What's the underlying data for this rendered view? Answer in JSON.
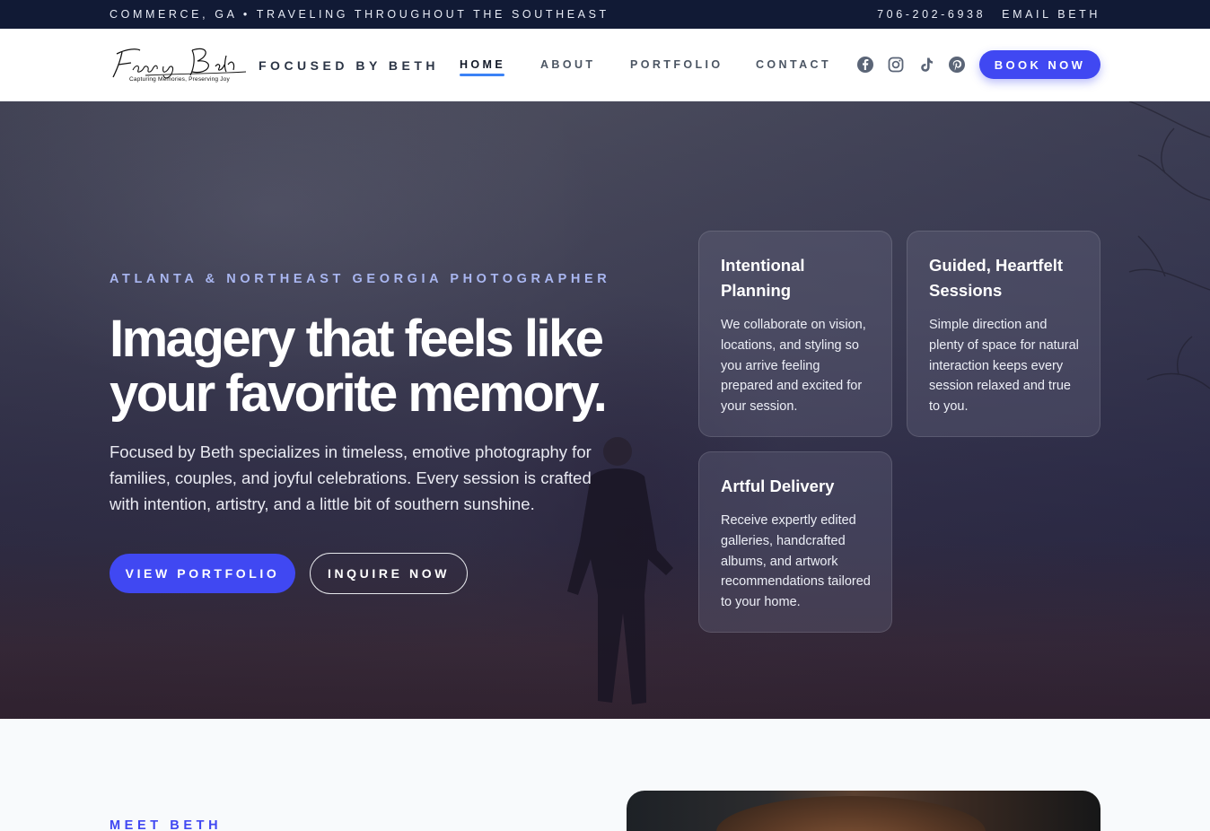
{
  "topbar": {
    "location": "COMMERCE, GA • TRAVELING THROUGHOUT THE SOUTHEAST",
    "phone": "706-202-6938",
    "email_label": "EMAIL BETH"
  },
  "nav": {
    "logo_script": "Focused by Beth",
    "logo_tagline": "Capturing Memories, Preserving Joy",
    "brand": "FOCUSED BY BETH",
    "items": [
      {
        "label": "HOME",
        "active": true
      },
      {
        "label": "ABOUT",
        "active": false
      },
      {
        "label": "PORTFOLIO",
        "active": false
      },
      {
        "label": "CONTACT",
        "active": false
      }
    ],
    "social": [
      "facebook-icon",
      "instagram-icon",
      "tiktok-icon",
      "pinterest-icon"
    ],
    "cta": "BOOK NOW"
  },
  "hero": {
    "eyebrow": "ATLANTA & NORTHEAST GEORGIA PHOTOGRAPHER",
    "headline": "Imagery that feels like your favorite memory.",
    "lead": "Focused by Beth specializes in timeless, emotive photography for families, couples, and joyful celebrations. Every session is crafted with intention, artistry, and a little bit of southern sunshine.",
    "primary_button": "VIEW PORTFOLIO",
    "secondary_button": "INQUIRE NOW",
    "cards": [
      {
        "title": "Intentional Planning",
        "body": "We collaborate on vision, locations, and styling so you arrive feeling prepared and excited for your session."
      },
      {
        "title": "Guided, Heartfelt Sessions",
        "body": "Simple direction and plenty of space for natural interaction keeps every session relaxed and true to you."
      },
      {
        "title": "Artful Delivery",
        "body": "Receive expertly edited galleries, handcrafted albums, and artwork recommendations tailored to your home."
      }
    ]
  },
  "about": {
    "eyebrow": "MEET BETH"
  },
  "colors": {
    "accent": "#4048f2",
    "topbar_bg": "#111a35",
    "eyebrow": "#a9b6f0"
  }
}
